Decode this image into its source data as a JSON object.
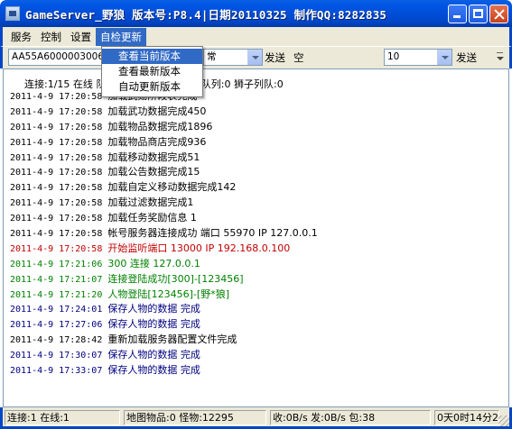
{
  "window": {
    "title": "GameServer_野狼 版本号:P8.4|日期20110325 制作QQ:8282835"
  },
  "menu": {
    "items": [
      "服务",
      "控制",
      "设置",
      "自检更新"
    ],
    "active_index": 3,
    "dropdown": [
      "查看当前版本",
      "查看最新版本",
      "自动更新版本"
    ],
    "highlight_index": 0
  },
  "toolbar": {
    "hex_field": "AA55A600000300660",
    "mode_field": "常",
    "send1_label": "发送",
    "empty_label": "空",
    "count_field": "10",
    "send2_label": "发送"
  },
  "stats": {
    "text": "连接:1/15 在线    队:0 离线队列:0 数据库队列:0 狮子列队:0"
  },
  "log": [
    {
      "ts": "2011-4-9 17:20:58",
      "msg": "加载武勋阶段表完成",
      "color": "#000000"
    },
    {
      "ts": "2011-4-9 17:20:58",
      "msg": "加载武功数据完成450",
      "color": "#000000"
    },
    {
      "ts": "2011-4-9 17:20:58",
      "msg": "加载物品数据完成1896",
      "color": "#000000"
    },
    {
      "ts": "2011-4-9 17:20:58",
      "msg": "加载物品商店完成936",
      "color": "#000000"
    },
    {
      "ts": "2011-4-9 17:20:58",
      "msg": "加载移动数据完成51",
      "color": "#000000"
    },
    {
      "ts": "2011-4-9 17:20:58",
      "msg": "加载公告数据完成15",
      "color": "#000000"
    },
    {
      "ts": "2011-4-9 17:20:58",
      "msg": "加载自定义移动数据完成142",
      "color": "#000000"
    },
    {
      "ts": "2011-4-9 17:20:58",
      "msg": "加载过滤数据完成1",
      "color": "#000000"
    },
    {
      "ts": "2011-4-9 17:20:58",
      "msg": "加载任务奖励信息 1",
      "color": "#000000"
    },
    {
      "ts": "2011-4-9 17:20:58",
      "msg": "帐号服务器连接成功 端口 55970 IP 127.0.0.1",
      "color": "#000000"
    },
    {
      "ts": "2011-4-9 17:20:58",
      "msg": "开始监听端口 13000 IP 192.168.0.100",
      "color": "#c00000"
    },
    {
      "ts": "2011-4-9 17:21:06",
      "msg": "300 连接 127.0.0.1",
      "color": "#008000"
    },
    {
      "ts": "2011-4-9 17:21:07",
      "msg": "连接登陆成功[300]-[123456]",
      "color": "#008000"
    },
    {
      "ts": "2011-4-9 17:21:20",
      "msg": "人物登陆[123456]-[野*狼]",
      "color": "#008000"
    },
    {
      "ts": "2011-4-9 17:24:01",
      "msg": "保存人物的数据 完成",
      "color": "#000080"
    },
    {
      "ts": "2011-4-9 17:27:06",
      "msg": "保存人物的数据 完成",
      "color": "#000080"
    },
    {
      "ts": "2011-4-9 17:28:42",
      "msg": "重新加载服务器配置文件完成",
      "color": "#000000"
    },
    {
      "ts": "2011-4-9 17:30:07",
      "msg": "保存人物的数据 完成",
      "color": "#000080"
    },
    {
      "ts": "2011-4-9 17:33:07",
      "msg": "保存人物的数据 完成",
      "color": "#000080"
    }
  ],
  "status": {
    "conn": "连接:1 在线:1",
    "map": "地图物品:0 怪物:12295",
    "traffic": "收:0B/s 发:0B/s 包:38",
    "uptime": "0天0时14分21"
  }
}
